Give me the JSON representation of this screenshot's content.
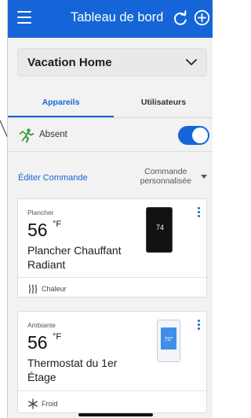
{
  "header": {
    "title": "Tableau de bord",
    "menu_icon": "hamburger-menu-icon",
    "refresh_icon": "refresh-icon",
    "add_icon": "add-circle-icon",
    "color": "#1565d8"
  },
  "location": {
    "selected": "Vacation Home",
    "chevron_icon": "chevron-down-icon"
  },
  "tabs": [
    {
      "label": "Appareils",
      "active": true
    },
    {
      "label": "Utilisateurs",
      "active": false
    }
  ],
  "away": {
    "label": "Absent",
    "icon": "away-person-icon",
    "enabled": true
  },
  "command": {
    "edit_label": "Éditer Commande",
    "select_line1": "Commande",
    "select_line2": "personnalisée"
  },
  "devices": [
    {
      "zone": "Plancher",
      "temperature": "56",
      "unit": "°F",
      "name": "Plancher Chauffant Radiant",
      "mode": "Chaleur",
      "mode_icon": "heat-waves-icon",
      "display_reading": "74"
    },
    {
      "zone": "Ambiante",
      "temperature": "56",
      "unit": "°F",
      "name": "Thermostat du 1er Étage",
      "mode": "Froid",
      "mode_icon": "snowflake-icon",
      "display_reading": "70°"
    }
  ]
}
